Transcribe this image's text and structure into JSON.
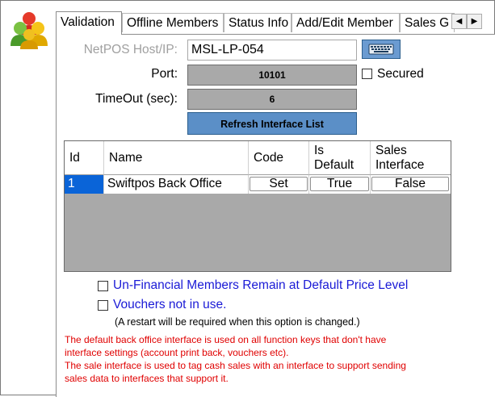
{
  "tabs": [
    {
      "label": "Validation",
      "active": true
    },
    {
      "label": "Offline Members",
      "active": false
    },
    {
      "label": "Status Info",
      "active": false
    },
    {
      "label": "Add/Edit Member",
      "active": false
    },
    {
      "label": "Sales G",
      "active": false
    }
  ],
  "tab_scroll": {
    "left": "◀",
    "right": "▶"
  },
  "host": {
    "label": "NetPOS Host/IP:",
    "value": "MSL-LP-054"
  },
  "port": {
    "label": "Port:",
    "value": "10101",
    "secured_label": "Secured",
    "secured_checked": false
  },
  "timeout": {
    "label": "TimeOut (sec):",
    "value": "6"
  },
  "refresh_button": "Refresh Interface List",
  "grid": {
    "columns": [
      "Id",
      "Name",
      "Code",
      "Is Default",
      "Sales Interface"
    ],
    "rows": [
      {
        "id": "1",
        "name": "Swiftpos  Back Office",
        "code": "Set",
        "is_default": "True",
        "sales_interface": "False"
      }
    ]
  },
  "options": [
    {
      "label": "Un-Financial Members Remain at Default Price Level",
      "checked": false
    },
    {
      "label": "Vouchers not in use.",
      "checked": false
    }
  ],
  "restart_note": "(A restart will be required when this option is changed.)",
  "info_lines": [
    "The default back office interface is used on all function keys that don't have",
    "interface settings (account print back, vouchers etc).",
    "The sale interface is used to tag cash sales with an interface to support sending",
    "sales data to interfaces that support it."
  ],
  "colors": {
    "accent_blue": "#5b8fc7",
    "info_red": "#e00000",
    "option_blue": "#1a1ad6",
    "field_gray": "#a9a9a9"
  },
  "icons": {
    "logo": "users-group-icon",
    "keyboard": "keyboard-icon"
  }
}
